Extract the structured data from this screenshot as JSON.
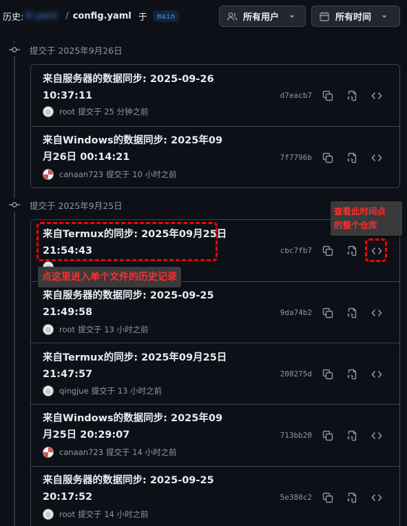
{
  "header": {
    "history_label": "历史:",
    "repo_name": "lll.yaml",
    "separator": "/",
    "file_name": "config.yaml",
    "in_label": "于",
    "branch": "main",
    "user_filter_label": "所有用户",
    "time_filter_label": "所有时间"
  },
  "groups": [
    {
      "date_label": "提交于 2025年9月26日",
      "commits": [
        {
          "message": "来自服务器的数据同步: 2025-09-26 10:37:11",
          "author": "root",
          "time_text": "提交于 25 分钟之前",
          "sha": "d7eacb7",
          "avatar": "root"
        },
        {
          "message": "来自Windows的数据同步: 2025年09月26日 00:14:21",
          "author": "canaan723",
          "time_text": "提交于 10 小时之前",
          "sha": "7f7796b",
          "avatar": "canaan"
        }
      ]
    },
    {
      "date_label": "提交于 2025年9月25日",
      "commits": [
        {
          "message": "来自Termux的同步: 2025年09月25日 21:54:43",
          "author": "",
          "time_text": "",
          "sha": "cbc7fb7",
          "avatar": "root"
        },
        {
          "message": "来自服务器的数据同步: 2025-09-25 21:49:58",
          "author": "root",
          "time_text": "提交于 13 小时之前",
          "sha": "9da74b2",
          "avatar": "root"
        },
        {
          "message": "来自Termux的同步: 2025年09月25日 21:47:57",
          "author": "qingjue",
          "time_text": "提交于 13 小时之前",
          "sha": "208275d",
          "avatar": "qing"
        },
        {
          "message": "来自Windows的数据同步: 2025年09月25日 20:29:07",
          "author": "canaan723",
          "time_text": "提交于 14 小时之前",
          "sha": "713bb20",
          "avatar": "canaan"
        },
        {
          "message": "来自服务器的数据同步: 2025-09-25 20:17:52",
          "author": "root",
          "time_text": "提交于 14 小时之前",
          "sha": "5e380c2",
          "avatar": "root"
        }
      ]
    }
  ],
  "annotations": {
    "file_history_tip": "点这里进入单个文件的历史记录",
    "repo_snapshot_tip": [
      "查看此时间点",
      "的整个仓库"
    ]
  },
  "icons": {
    "copy": "copy-icon",
    "file_diff": "file-code-icon",
    "browse": "code-icon",
    "commit": "git-commit-icon",
    "people": "people-icon",
    "calendar": "calendar-icon"
  },
  "colors": {
    "background": "#0d1117",
    "border": "#3d444d",
    "text": "#e6edf3",
    "muted": "#9198a1",
    "link": "#4493f8",
    "annotation": "#ff0000"
  }
}
